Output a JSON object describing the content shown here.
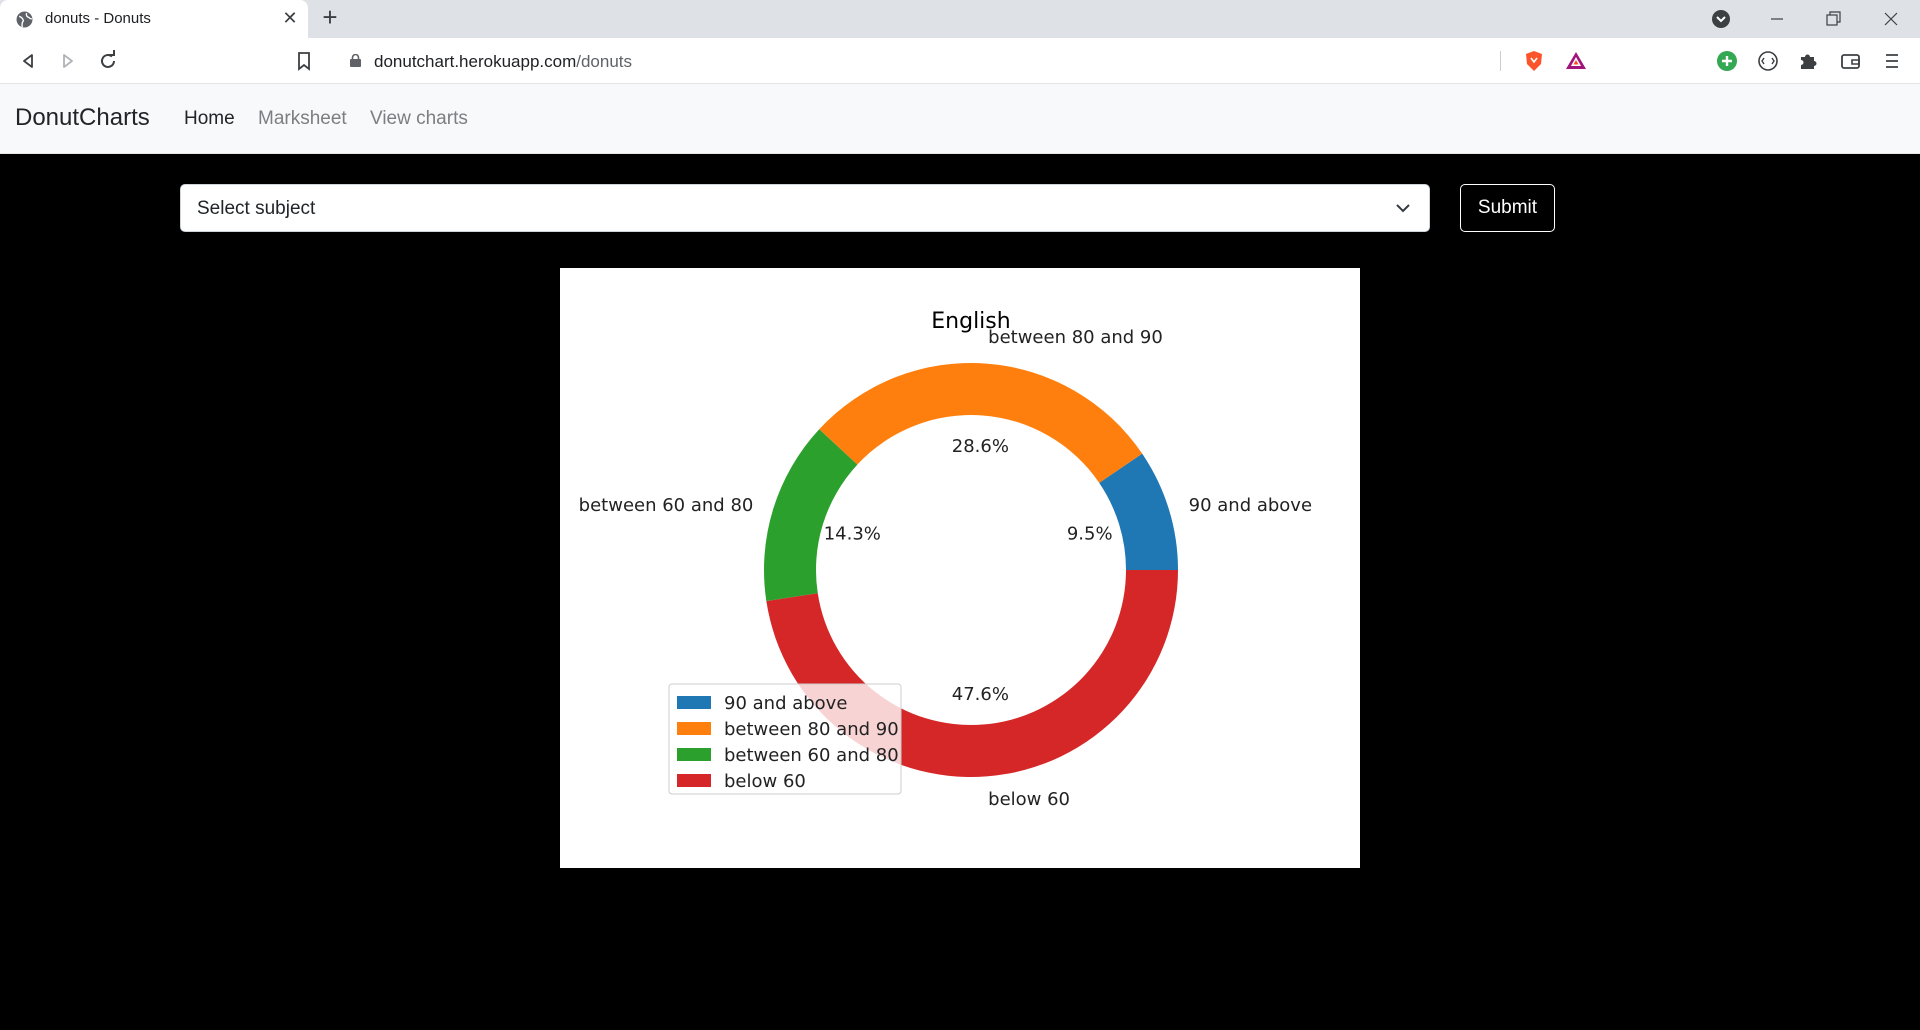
{
  "browser": {
    "tab_title": "donuts - Donuts",
    "url_host": "donutchart.herokuapp.com",
    "url_path": "/donuts"
  },
  "navbar": {
    "brand": "DonutCharts",
    "links": [
      {
        "label": "Home"
      },
      {
        "label": "Marksheet"
      },
      {
        "label": "View charts"
      }
    ]
  },
  "form": {
    "select_value": "Select subject",
    "submit_label": "Submit"
  },
  "chart_data": {
    "type": "pie",
    "subtype": "donut",
    "title": "English",
    "categories": [
      "90 and above",
      "between 80 and 90",
      "between 60 and 80",
      "below 60"
    ],
    "values": [
      9.5,
      28.6,
      14.3,
      47.6
    ],
    "value_labels": [
      "9.5%",
      "28.6%",
      "14.3%",
      "47.6%"
    ],
    "colors": [
      "#1f77b4",
      "#ff7f0e",
      "#2ca02c",
      "#d62728"
    ],
    "legend_placement": "lower-left"
  }
}
